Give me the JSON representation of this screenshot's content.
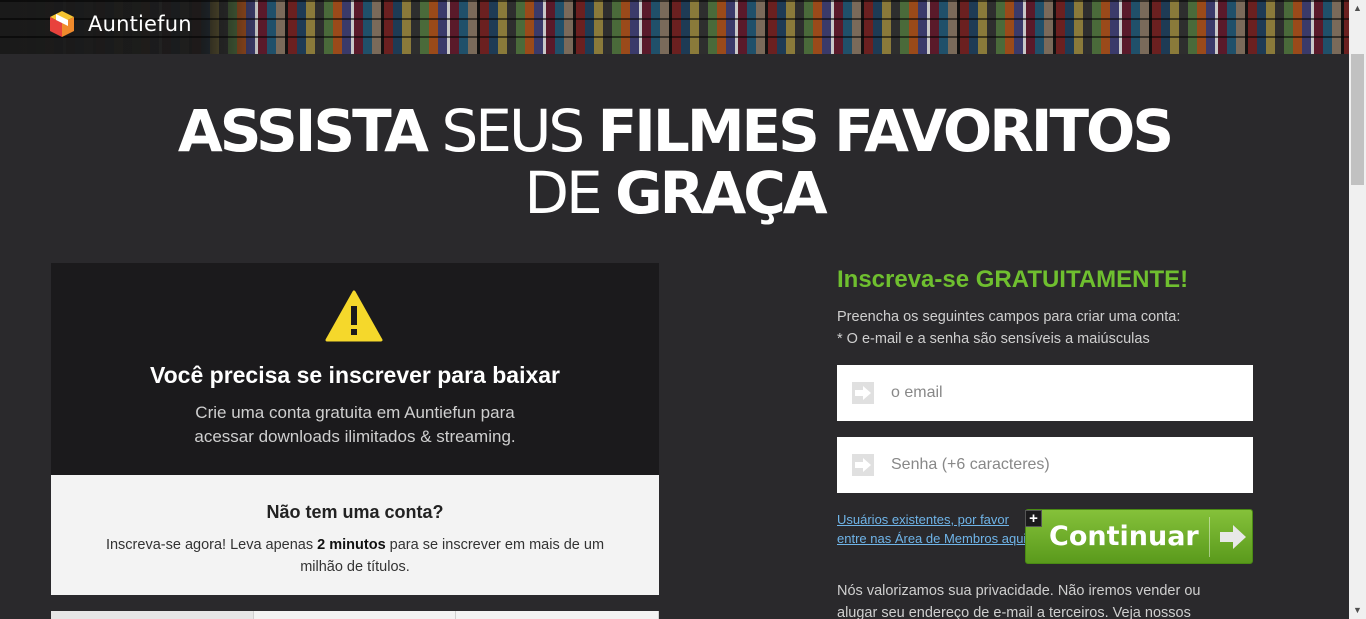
{
  "header": {
    "brand_name": "Auntiefun",
    "logo_icon": "gift-box-icon"
  },
  "hero": {
    "line1_bold_a": "ASSISTA",
    "line1_light": "SEUS",
    "line1_bold_b": "FILMES FAVORITOS",
    "line2_light": "DE",
    "line2_bold": "GRAÇA"
  },
  "notice": {
    "icon": "warning-icon",
    "title": "Você precisa se inscrever para baixar",
    "text": "Crie uma conta gratuita em Auntiefun para acessar downloads ilimitados & streaming."
  },
  "no_account": {
    "title": "Não tem uma conta?",
    "text_before": "Inscreva-se agora! Leva apenas ",
    "text_bold": "2 minutos",
    "text_after": " para se inscrever em mais de um milhão de títulos."
  },
  "form": {
    "title": "Inscreva-se GRATUITAMENTE!",
    "desc_line1": "Preencha os seguintes campos para criar uma conta:",
    "desc_line2": "* O e-mail e a senha são sensíveis a maiúsculas",
    "email_placeholder": "o email",
    "password_placeholder": "Senha (+6 caracteres)",
    "existing_link_line1": "Usuários existentes, por favor",
    "existing_link_line2": "entre nas Área de Membros aqui",
    "continue_label": "Continuar",
    "plus_label": "+",
    "privacy_text": "Nós valorizamos sua privacidade. Não iremos vender ou alugar seu endereço de e-mail a terceiros. Veja nossos",
    "accent_color": "#6fbf2f",
    "button_color": "#6fae28"
  }
}
